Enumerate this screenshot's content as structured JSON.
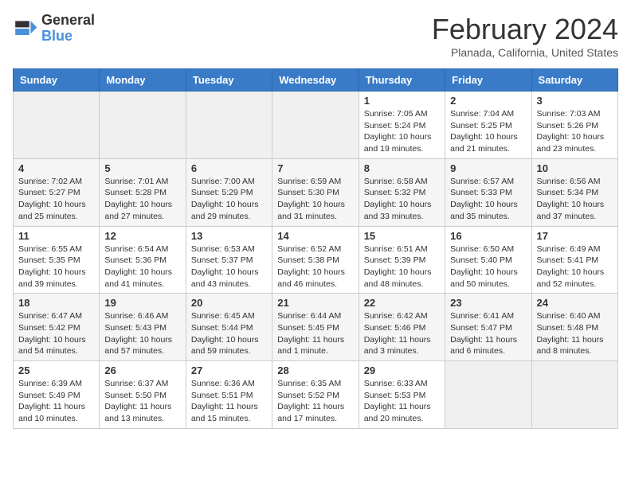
{
  "header": {
    "logo_line1": "General",
    "logo_line2": "Blue",
    "month": "February 2024",
    "location": "Planada, California, United States"
  },
  "weekdays": [
    "Sunday",
    "Monday",
    "Tuesday",
    "Wednesday",
    "Thursday",
    "Friday",
    "Saturday"
  ],
  "weeks": [
    [
      {
        "day": "",
        "info": ""
      },
      {
        "day": "",
        "info": ""
      },
      {
        "day": "",
        "info": ""
      },
      {
        "day": "",
        "info": ""
      },
      {
        "day": "1",
        "info": "Sunrise: 7:05 AM\nSunset: 5:24 PM\nDaylight: 10 hours and 19 minutes."
      },
      {
        "day": "2",
        "info": "Sunrise: 7:04 AM\nSunset: 5:25 PM\nDaylight: 10 hours and 21 minutes."
      },
      {
        "day": "3",
        "info": "Sunrise: 7:03 AM\nSunset: 5:26 PM\nDaylight: 10 hours and 23 minutes."
      }
    ],
    [
      {
        "day": "4",
        "info": "Sunrise: 7:02 AM\nSunset: 5:27 PM\nDaylight: 10 hours and 25 minutes."
      },
      {
        "day": "5",
        "info": "Sunrise: 7:01 AM\nSunset: 5:28 PM\nDaylight: 10 hours and 27 minutes."
      },
      {
        "day": "6",
        "info": "Sunrise: 7:00 AM\nSunset: 5:29 PM\nDaylight: 10 hours and 29 minutes."
      },
      {
        "day": "7",
        "info": "Sunrise: 6:59 AM\nSunset: 5:30 PM\nDaylight: 10 hours and 31 minutes."
      },
      {
        "day": "8",
        "info": "Sunrise: 6:58 AM\nSunset: 5:32 PM\nDaylight: 10 hours and 33 minutes."
      },
      {
        "day": "9",
        "info": "Sunrise: 6:57 AM\nSunset: 5:33 PM\nDaylight: 10 hours and 35 minutes."
      },
      {
        "day": "10",
        "info": "Sunrise: 6:56 AM\nSunset: 5:34 PM\nDaylight: 10 hours and 37 minutes."
      }
    ],
    [
      {
        "day": "11",
        "info": "Sunrise: 6:55 AM\nSunset: 5:35 PM\nDaylight: 10 hours and 39 minutes."
      },
      {
        "day": "12",
        "info": "Sunrise: 6:54 AM\nSunset: 5:36 PM\nDaylight: 10 hours and 41 minutes."
      },
      {
        "day": "13",
        "info": "Sunrise: 6:53 AM\nSunset: 5:37 PM\nDaylight: 10 hours and 43 minutes."
      },
      {
        "day": "14",
        "info": "Sunrise: 6:52 AM\nSunset: 5:38 PM\nDaylight: 10 hours and 46 minutes."
      },
      {
        "day": "15",
        "info": "Sunrise: 6:51 AM\nSunset: 5:39 PM\nDaylight: 10 hours and 48 minutes."
      },
      {
        "day": "16",
        "info": "Sunrise: 6:50 AM\nSunset: 5:40 PM\nDaylight: 10 hours and 50 minutes."
      },
      {
        "day": "17",
        "info": "Sunrise: 6:49 AM\nSunset: 5:41 PM\nDaylight: 10 hours and 52 minutes."
      }
    ],
    [
      {
        "day": "18",
        "info": "Sunrise: 6:47 AM\nSunset: 5:42 PM\nDaylight: 10 hours and 54 minutes."
      },
      {
        "day": "19",
        "info": "Sunrise: 6:46 AM\nSunset: 5:43 PM\nDaylight: 10 hours and 57 minutes."
      },
      {
        "day": "20",
        "info": "Sunrise: 6:45 AM\nSunset: 5:44 PM\nDaylight: 10 hours and 59 minutes."
      },
      {
        "day": "21",
        "info": "Sunrise: 6:44 AM\nSunset: 5:45 PM\nDaylight: 11 hours and 1 minute."
      },
      {
        "day": "22",
        "info": "Sunrise: 6:42 AM\nSunset: 5:46 PM\nDaylight: 11 hours and 3 minutes."
      },
      {
        "day": "23",
        "info": "Sunrise: 6:41 AM\nSunset: 5:47 PM\nDaylight: 11 hours and 6 minutes."
      },
      {
        "day": "24",
        "info": "Sunrise: 6:40 AM\nSunset: 5:48 PM\nDaylight: 11 hours and 8 minutes."
      }
    ],
    [
      {
        "day": "25",
        "info": "Sunrise: 6:39 AM\nSunset: 5:49 PM\nDaylight: 11 hours and 10 minutes."
      },
      {
        "day": "26",
        "info": "Sunrise: 6:37 AM\nSunset: 5:50 PM\nDaylight: 11 hours and 13 minutes."
      },
      {
        "day": "27",
        "info": "Sunrise: 6:36 AM\nSunset: 5:51 PM\nDaylight: 11 hours and 15 minutes."
      },
      {
        "day": "28",
        "info": "Sunrise: 6:35 AM\nSunset: 5:52 PM\nDaylight: 11 hours and 17 minutes."
      },
      {
        "day": "29",
        "info": "Sunrise: 6:33 AM\nSunset: 5:53 PM\nDaylight: 11 hours and 20 minutes."
      },
      {
        "day": "",
        "info": ""
      },
      {
        "day": "",
        "info": ""
      }
    ]
  ]
}
